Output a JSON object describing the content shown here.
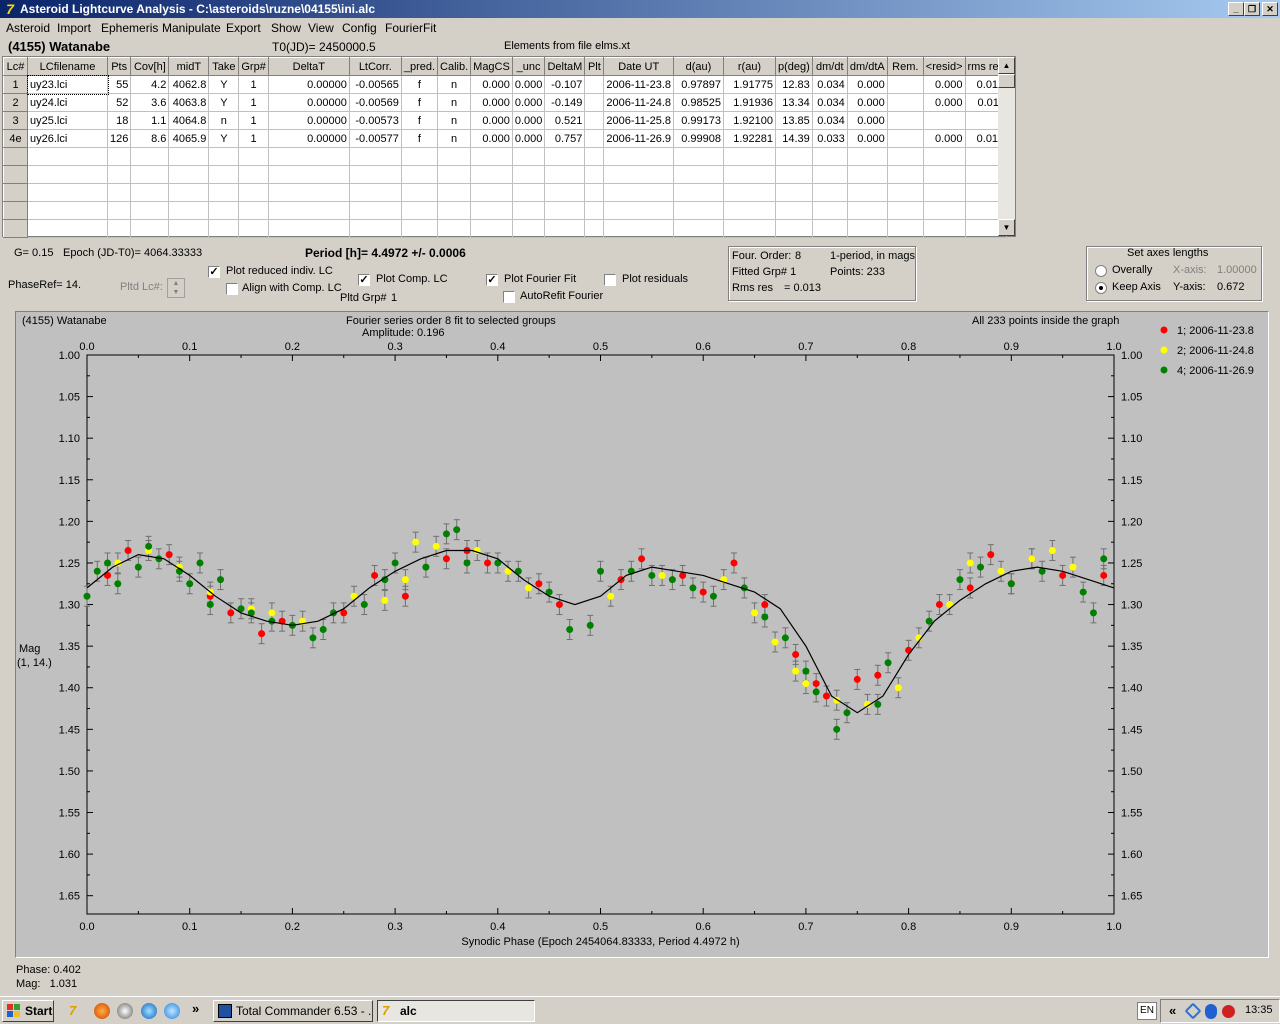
{
  "window": {
    "title": "Asteroid Lightcurve Analysis - C:\\asteroids\\ruzne\\04155\\ini.alc",
    "app_icon": "7",
    "buttons": [
      "_",
      "❐",
      "✕"
    ]
  },
  "menu": [
    "Asteroid",
    "Import",
    "Ephemeris",
    "Manipulate",
    "Export",
    "Show",
    "View",
    "Config",
    "FourierFit"
  ],
  "header": {
    "object": "(4155) Watanabe",
    "t0": "T0(JD)= 2450000.5",
    "elements": "Elements from file elms.xt"
  },
  "table": {
    "columns": [
      "Lc#",
      "LCfilename",
      "Pts",
      "Cov[h]",
      "midT",
      "Take",
      "Grp#",
      "DeltaT",
      "LtCorr.",
      "_pred.",
      "Calib.",
      "MagCS",
      "_unc",
      "DeltaM",
      "Plt",
      "Date UT",
      "d(au)",
      "r(au)",
      "p(deg)",
      "dm/dt",
      "dm/dtA",
      "Rem.",
      "<resid>",
      "rms res"
    ],
    "rows": [
      [
        "1",
        "uy23.lci",
        "55",
        "4.2",
        "4062.8",
        "Y",
        "1",
        "0.00000",
        "-0.00565",
        "f",
        "n",
        "0.000",
        "0.000",
        "-0.107",
        "",
        "2006-11-23.8",
        "0.97897",
        "1.91775",
        "12.83",
        "0.034",
        "0.000",
        "",
        "0.000",
        "0.013"
      ],
      [
        "2",
        "uy24.lci",
        "52",
        "3.6",
        "4063.8",
        "Y",
        "1",
        "0.00000",
        "-0.00569",
        "f",
        "n",
        "0.000",
        "0.000",
        "-0.149",
        "",
        "2006-11-24.8",
        "0.98525",
        "1.91936",
        "13.34",
        "0.034",
        "0.000",
        "",
        "0.000",
        "0.011"
      ],
      [
        "3",
        "uy25.lci",
        "18",
        "1.1",
        "4064.8",
        "n",
        "1",
        "0.00000",
        "-0.00573",
        "f",
        "n",
        "0.000",
        "0.000",
        "0.521",
        "",
        "2006-11-25.8",
        "0.99173",
        "1.92100",
        "13.85",
        "0.034",
        "0.000",
        "",
        "",
        ""
      ],
      [
        "4e",
        "uy26.lci",
        "126",
        "8.6",
        "4065.9",
        "Y",
        "1",
        "0.00000",
        "-0.00577",
        "f",
        "n",
        "0.000",
        "0.000",
        "0.757",
        "",
        "2006-11-26.9",
        "0.99908",
        "1.92281",
        "14.39",
        "0.033",
        "0.000",
        "",
        "0.000",
        "0.013"
      ]
    ],
    "empty_rows": 5,
    "scroll_up": "▲",
    "scroll_down": "▼"
  },
  "info": {
    "g": "G= 0.15",
    "epoch": "Epoch (JD-T0)= 4064.33333",
    "period": "Period [h]= 4.4972 +/- 0.0006",
    "phaseref": "PhaseRef= 14.",
    "pltd_lc": "Pltd Lc#:",
    "pltd_grp": "Pltd Grp#",
    "pltd_grp_value": "1"
  },
  "checks": {
    "plot_reduced": {
      "label": "Plot reduced indiv. LC",
      "checked": true
    },
    "align_comp": {
      "label": "Align with Comp. LC",
      "checked": false
    },
    "plot_comp": {
      "label": "Plot Comp. LC",
      "checked": true
    },
    "plot_fourier": {
      "label": "Plot Fourier Fit",
      "checked": true
    },
    "plot_residuals": {
      "label": "Plot residuals",
      "checked": false
    },
    "autorefit": {
      "label": "AutoRefit Fourier",
      "checked": false
    }
  },
  "fourier_box": {
    "order": "Four. Order:",
    "order_value": "8",
    "period_mode": "1-period, in mags",
    "fitted_grp": "Fitted Grp# 1",
    "points": "Points: 233",
    "rms": "Rms res",
    "rms_value": "= 0.013"
  },
  "axes_box": {
    "title": "Set axes lengths",
    "overally": "Overally",
    "keep_axis": "Keep Axis",
    "x_axis_label": "X-axis:",
    "x_axis_value": "1.00000",
    "y_axis_label": "Y-axis:",
    "y_axis_value": "0.672",
    "selected": "keep_axis"
  },
  "graph": {
    "name": "(4155) Watanabe",
    "fit_desc": "Fourier series order 8 fit to selected groups",
    "amplitude": "Amplitude: 0.196",
    "inside": "All 233 points inside the graph",
    "ylabel": "Mag",
    "ylabel2": "(1, 14.)"
  },
  "chart_data": {
    "type": "scatter",
    "title": "Fourier series order 8 fit to selected groups",
    "subtitle": "Amplitude: 0.196",
    "xlabel": "Synodic Phase (Epoch 2454064.83333, Period 4.4972 h)",
    "ylabel": "Mag",
    "xlim": [
      0,
      1
    ],
    "ylim": [
      1.0,
      1.672
    ],
    "y_inverted": true,
    "xticks": [
      "0.0",
      "0.1",
      "0.2",
      "0.3",
      "0.4",
      "0.5",
      "0.6",
      "0.7",
      "0.8",
      "0.9",
      "1.0"
    ],
    "yticks": [
      "1.00",
      "1.05",
      "1.10",
      "1.15",
      "1.20",
      "1.25",
      "1.30",
      "1.35",
      "1.40",
      "1.45",
      "1.50",
      "1.55",
      "1.60",
      "1.65"
    ],
    "legend_placement": "right",
    "error_bar_color": "#707070",
    "fit_color": "#000000",
    "fit_curve": {
      "x": [
        0.0,
        0.025,
        0.05,
        0.075,
        0.1,
        0.125,
        0.15,
        0.175,
        0.2,
        0.225,
        0.25,
        0.275,
        0.3,
        0.325,
        0.35,
        0.375,
        0.4,
        0.425,
        0.45,
        0.475,
        0.5,
        0.525,
        0.55,
        0.575,
        0.6,
        0.625,
        0.65,
        0.675,
        0.7,
        0.725,
        0.75,
        0.775,
        0.8,
        0.825,
        0.85,
        0.875,
        0.9,
        0.925,
        0.95,
        0.975,
        1.0
      ],
      "y": [
        1.28,
        1.255,
        1.24,
        1.245,
        1.265,
        1.29,
        1.31,
        1.32,
        1.325,
        1.32,
        1.305,
        1.28,
        1.26,
        1.245,
        1.235,
        1.235,
        1.245,
        1.27,
        1.29,
        1.3,
        1.29,
        1.265,
        1.255,
        1.26,
        1.265,
        1.275,
        1.285,
        1.305,
        1.35,
        1.41,
        1.43,
        1.41,
        1.36,
        1.32,
        1.295,
        1.275,
        1.26,
        1.255,
        1.26,
        1.27,
        1.28
      ]
    },
    "series": [
      {
        "name": "1; 2006-11-23.8",
        "color": "#ff0000",
        "x": [
          0.02,
          0.04,
          0.08,
          0.12,
          0.14,
          0.17,
          0.19,
          0.25,
          0.28,
          0.31,
          0.35,
          0.37,
          0.39,
          0.44,
          0.46,
          0.52,
          0.54,
          0.58,
          0.6,
          0.63,
          0.66,
          0.69,
          0.71,
          0.72,
          0.75,
          0.77,
          0.8,
          0.83,
          0.86,
          0.88,
          0.9,
          0.92,
          0.95,
          0.99
        ],
        "y": [
          1.265,
          1.235,
          1.24,
          1.29,
          1.31,
          1.335,
          1.32,
          1.31,
          1.265,
          1.29,
          1.245,
          1.235,
          1.25,
          1.275,
          1.3,
          1.27,
          1.245,
          1.265,
          1.285,
          1.25,
          1.3,
          1.36,
          1.395,
          1.41,
          1.39,
          1.385,
          1.355,
          1.3,
          1.28,
          1.24,
          1.275,
          1.245,
          1.265,
          1.265
        ]
      },
      {
        "name": "2; 2006-11-24.8",
        "color": "#ffff00",
        "x": [
          0.03,
          0.06,
          0.09,
          0.12,
          0.16,
          0.18,
          0.21,
          0.26,
          0.29,
          0.31,
          0.32,
          0.34,
          0.38,
          0.41,
          0.43,
          0.51,
          0.56,
          0.62,
          0.65,
          0.67,
          0.69,
          0.7,
          0.73,
          0.76,
          0.79,
          0.81,
          0.84,
          0.86,
          0.89,
          0.92,
          0.94,
          0.96
        ],
        "y": [
          1.25,
          1.235,
          1.255,
          1.285,
          1.305,
          1.31,
          1.32,
          1.29,
          1.295,
          1.27,
          1.225,
          1.23,
          1.235,
          1.26,
          1.28,
          1.29,
          1.265,
          1.27,
          1.31,
          1.345,
          1.38,
          1.395,
          1.415,
          1.42,
          1.4,
          1.34,
          1.3,
          1.25,
          1.26,
          1.245,
          1.235,
          1.255
        ]
      },
      {
        "name": "4; 2006-11-26.9",
        "color": "#008000",
        "x": [
          0.0,
          0.01,
          0.02,
          0.03,
          0.05,
          0.06,
          0.07,
          0.09,
          0.1,
          0.11,
          0.12,
          0.13,
          0.15,
          0.16,
          0.18,
          0.2,
          0.22,
          0.23,
          0.24,
          0.27,
          0.29,
          0.3,
          0.33,
          0.35,
          0.36,
          0.37,
          0.4,
          0.42,
          0.45,
          0.47,
          0.49,
          0.5,
          0.53,
          0.55,
          0.57,
          0.59,
          0.61,
          0.64,
          0.66,
          0.68,
          0.7,
          0.71,
          0.73,
          0.74,
          0.77,
          0.78,
          0.82,
          0.85,
          0.87,
          0.9,
          0.93,
          0.97,
          0.98,
          0.99
        ],
        "y": [
          1.29,
          1.26,
          1.25,
          1.275,
          1.255,
          1.23,
          1.245,
          1.26,
          1.275,
          1.25,
          1.3,
          1.27,
          1.305,
          1.31,
          1.32,
          1.325,
          1.34,
          1.33,
          1.31,
          1.3,
          1.27,
          1.25,
          1.255,
          1.215,
          1.21,
          1.25,
          1.25,
          1.26,
          1.285,
          1.33,
          1.325,
          1.26,
          1.26,
          1.265,
          1.27,
          1.28,
          1.29,
          1.28,
          1.315,
          1.34,
          1.38,
          1.405,
          1.45,
          1.43,
          1.42,
          1.37,
          1.32,
          1.27,
          1.255,
          1.275,
          1.26,
          1.285,
          1.31,
          1.245
        ]
      }
    ]
  },
  "phase_readout": {
    "phase": "Phase: 0.402",
    "mag": "Mag:   1.031"
  },
  "taskbar": {
    "start": "Start",
    "quick_more": "»",
    "task1": "Total Commander 6.53 - ...",
    "task2": "alc",
    "lang": "EN",
    "tray_more": "«",
    "clock": "13:35"
  }
}
